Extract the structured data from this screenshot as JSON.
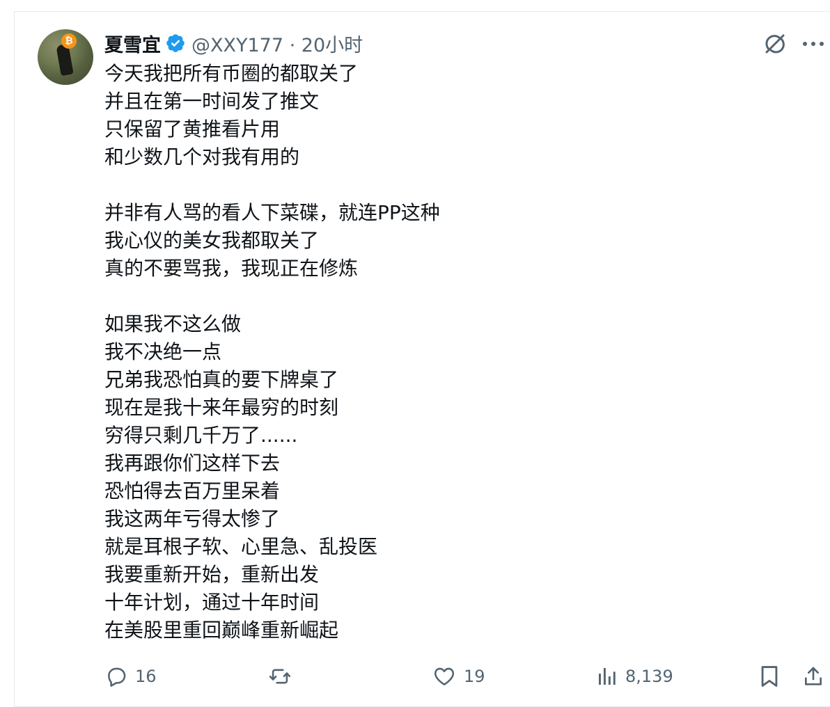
{
  "author": {
    "display_name": "夏雪宜",
    "handle_time": "@XXY177 · 20小时"
  },
  "tweet": {
    "lines": [
      "今天我把所有币圈的都取关了",
      "并且在第一时间发了推文",
      "只保留了黄推看片用",
      "和少数几个对我有用的",
      "",
      "并非有人骂的看人下菜碟，就连PP这种",
      "我心仪的美女我都取关了",
      "真的不要骂我，我现正在修炼",
      "",
      "如果我不这么做",
      "我不决绝一点",
      "兄弟我恐怕真的要下牌桌了",
      "现在是我十来年最穷的时刻",
      "穷得只剩几千万了......",
      "我再跟你们这样下去",
      "恐怕得去百万里呆着",
      "我这两年亏得太惨了",
      "就是耳根子软、心里急、乱投医",
      "我要重新开始，重新出发",
      "十年计划，通过十年时间",
      "在美股里重回巅峰重新崛起"
    ]
  },
  "actions": {
    "replies": "16",
    "likes": "19",
    "views": "8,139"
  },
  "icons": {
    "avatar_badge": "bitcoin-icon",
    "verified": "verified-badge-icon",
    "grok": "grok-icon",
    "more": "more-icon",
    "reply": "reply-icon",
    "retweet": "retweet-icon",
    "like": "heart-icon",
    "views": "views-icon",
    "bookmark": "bookmark-icon",
    "share": "share-icon"
  },
  "colors": {
    "verified_blue": "#1d9bf0",
    "muted_text": "#536471",
    "text": "#0f1419",
    "bitcoin_orange": "#f7931a"
  }
}
